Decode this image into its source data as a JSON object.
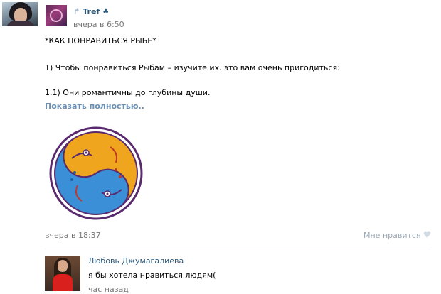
{
  "post": {
    "author": "Tref",
    "reshare_icon": "reshare-arrow-icon",
    "badge_icon": "club-suit-icon",
    "time": "вчера в 6:50",
    "lines": [
      "*КАК ПОНРАВИТЬСЯ РЫБЕ*",
      "1) Чтобы понравиться Рыбам – изучите их, это вам очень пригодиться:",
      "1.1) Они романтичны до глубины души."
    ],
    "show_more": "Показать полностью..",
    "image_icon": "pisces-fish-yin-yang-image",
    "date": "вчера в 18:37",
    "like_label": "Мне нравится",
    "colors": {
      "link": "#2b587a",
      "muted_link": "#6b8fb3",
      "meta": "#777777",
      "fish_blue": "#3a8fd6",
      "fish_orange": "#f0a51e",
      "outline": "#5a2a6e"
    }
  },
  "comment": {
    "author": "Любовь Джумагалиева",
    "text": "я бы хотела нравиться людям(",
    "time": "час назад"
  }
}
